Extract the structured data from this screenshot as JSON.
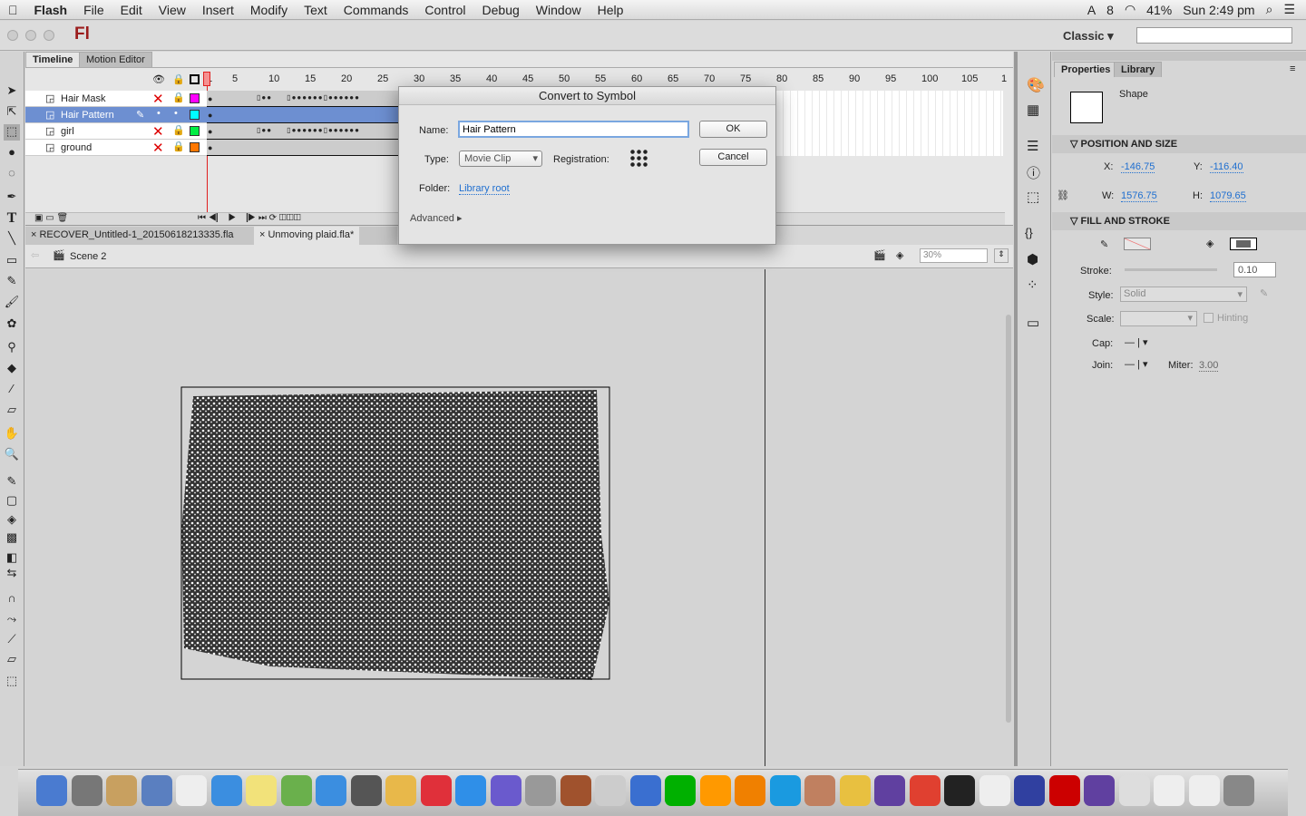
{
  "menubar": {
    "app": "Flash",
    "items": [
      "File",
      "Edit",
      "View",
      "Insert",
      "Modify",
      "Text",
      "Commands",
      "Control",
      "Debug",
      "Window",
      "Help"
    ],
    "status": {
      "badge": "8",
      "battery": "41%",
      "clock": "Sun 2:49 pm"
    }
  },
  "appbar": {
    "logo": "Fl",
    "workspace": "Classic ▾",
    "search_placeholder": ""
  },
  "timeline": {
    "tabs": [
      "Timeline",
      "Motion Editor"
    ],
    "frame_numbers": [
      "1",
      "5",
      "10",
      "15",
      "20",
      "25",
      "30",
      "35",
      "40",
      "45",
      "50",
      "55",
      "60",
      "65",
      "70",
      "75",
      "80",
      "85",
      "90",
      "95",
      "100",
      "105",
      "1"
    ],
    "layers": [
      {
        "name": "Hair Mask",
        "color": "#ff00ff",
        "selected": false
      },
      {
        "name": "Hair Pattern",
        "color": "#00ffff",
        "selected": true
      },
      {
        "name": "girl",
        "color": "#00ee44",
        "selected": false
      },
      {
        "name": "ground",
        "color": "#ff7700",
        "selected": false
      }
    ]
  },
  "doc_tabs": [
    "RECOVER_Untitled-1_20150618213335.fla",
    "Unmoving plaid.fla*"
  ],
  "editbar": {
    "scene": "Scene 2",
    "zoom": "30%"
  },
  "dialog": {
    "title": "Convert to Symbol",
    "name_label": "Name:",
    "name_value": "Hair Pattern",
    "type_label": "Type:",
    "type_value": "Movie Clip",
    "registration_label": "Registration:",
    "folder_label": "Folder:",
    "folder_value": "Library root",
    "advanced": "Advanced",
    "ok": "OK",
    "cancel": "Cancel"
  },
  "properties": {
    "tabs": [
      "Properties",
      "Library"
    ],
    "object_type": "Shape",
    "position_size": {
      "title": "POSITION AND SIZE",
      "x_label": "X:",
      "x": "-146.75",
      "y_label": "Y:",
      "y": "-116.40",
      "w_label": "W:",
      "w": "1576.75",
      "h_label": "H:",
      "h": "1079.65"
    },
    "fill_stroke": {
      "title": "FILL AND STROKE",
      "stroke_label": "Stroke:",
      "stroke": "0.10",
      "style_label": "Style:",
      "style": "Solid",
      "scale_label": "Scale:",
      "hinting": "Hinting",
      "cap_label": "Cap:",
      "join_label": "Join:",
      "miter_label": "Miter:",
      "miter": "3.00"
    }
  },
  "colors": {
    "selection": "#6d8fd1",
    "link": "#1f6fd0",
    "playhead": "#e02020"
  }
}
